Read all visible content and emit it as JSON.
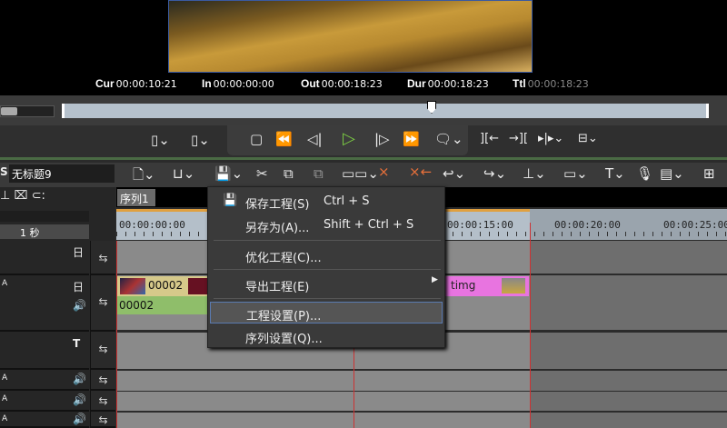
{
  "timecodes": {
    "cur_label": "Cur",
    "cur": "00:00:10:21",
    "in_label": "In",
    "in": "00:00:00:00",
    "out_label": "Out",
    "out": "00:00:18:23",
    "dur_label": "Dur",
    "dur": "00:00:18:23",
    "ttl_label": "Ttl",
    "ttl": "00:00:18:23"
  },
  "project": {
    "name": "无标题9",
    "logo_letter": "S"
  },
  "sequence_tab": "序列1",
  "timeline": {
    "scale": "1 秒",
    "ruler": [
      "00:00:00:00",
      "00:00:15:00",
      "00:00:20:00",
      "00:00:25:00"
    ]
  },
  "clips": {
    "video_label": "00002",
    "audio_label": "00002",
    "pink_label": "timg"
  },
  "menu": {
    "items": [
      {
        "label": "保存工程(S)",
        "shortcut": "Ctrl + S",
        "icon": "save-icon"
      },
      {
        "label": "另存为(A)...",
        "shortcut": "Shift + Ctrl + S"
      },
      {
        "label": "优化工程(C)..."
      },
      {
        "label": "导出工程(E)",
        "submenu": true
      },
      {
        "label": "工程设置(P)...",
        "highlighted": true
      },
      {
        "label": "序列设置(Q)..."
      }
    ]
  },
  "colors": {
    "play": "#7ac943",
    "highlight": "#5a7ab0",
    "clip_video": "#d6c98a",
    "clip_audio": "#8fbe6a",
    "clip_pink": "#e874e0"
  }
}
